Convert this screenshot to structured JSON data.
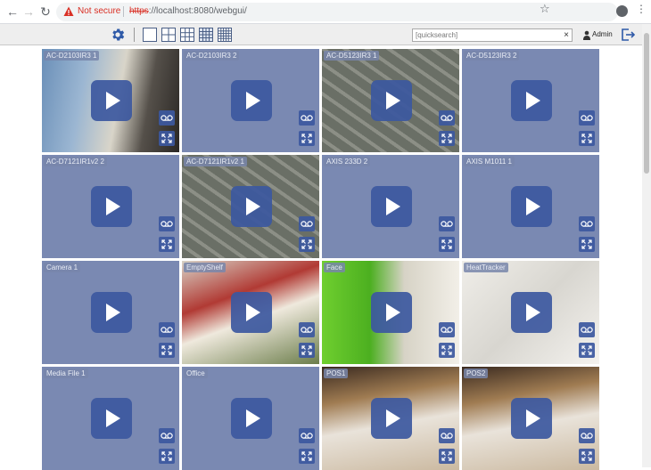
{
  "browser": {
    "security_label": "Not secure",
    "url_scheme": "https",
    "url_rest": "://localhost:8080/webgui/"
  },
  "toolbar": {
    "search_placeholder": "[quicksearch]",
    "search_clear": "×",
    "user_name": "Admin",
    "active_layout": "4x4"
  },
  "tiles": [
    {
      "label": "AC-D2103IR3 1",
      "scene": "street"
    },
    {
      "label": "AC-D2103IR3 2",
      "scene": "none"
    },
    {
      "label": "AC-D5123IR3 1",
      "scene": "parking"
    },
    {
      "label": "AC-D5123IR3 2",
      "scene": "none"
    },
    {
      "label": "AC-D7121IR1v2 2",
      "scene": "none"
    },
    {
      "label": "AC-D7121IR1v2 1",
      "scene": "parking"
    },
    {
      "label": "AXIS 233D 2",
      "scene": "none"
    },
    {
      "label": "AXIS M1011 1",
      "scene": "none"
    },
    {
      "label": "Camera 1",
      "scene": "none"
    },
    {
      "label": "EmptyShelf",
      "scene": "store"
    },
    {
      "label": "Face",
      "scene": "corridor"
    },
    {
      "label": "HeatTracker",
      "scene": "hall"
    },
    {
      "label": "Media File 1",
      "scene": "none"
    },
    {
      "label": "Office",
      "scene": "none"
    },
    {
      "label": "POS1",
      "scene": "pos"
    },
    {
      "label": "POS2",
      "scene": "pos"
    }
  ],
  "colors": {
    "tile_bg": "#7a89b2",
    "button_bg": "#3c58a0",
    "accent": "#2f5aa8"
  }
}
